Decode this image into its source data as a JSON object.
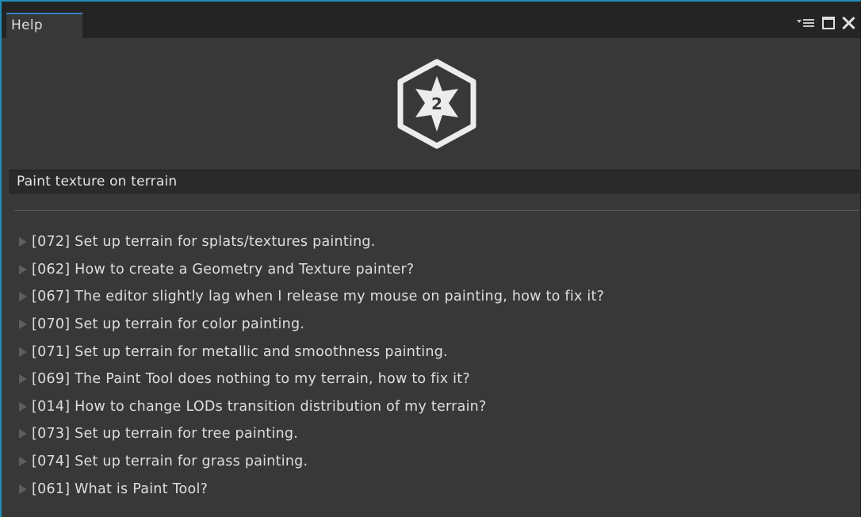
{
  "window": {
    "tab_title": "Help"
  },
  "logo": {
    "badge_text": "2",
    "icon": "star-hexagon-logo-icon"
  },
  "search": {
    "value": "Paint texture on terrain"
  },
  "results": [
    {
      "label": "[072] Set up terrain for splats/textures painting."
    },
    {
      "label": "[062] How to create a Geometry and Texture painter?"
    },
    {
      "label": "[067] The editor slightly lag when I release my mouse on painting, how to fix it?"
    },
    {
      "label": "[070] Set up terrain for color painting."
    },
    {
      "label": "[071] Set up terrain for metallic and smoothness painting."
    },
    {
      "label": "[069] The Paint Tool does nothing to my terrain, how to fix it?"
    },
    {
      "label": "[014] How to change LODs transition distribution of my terrain?"
    },
    {
      "label": "[073] Set up terrain for tree painting."
    },
    {
      "label": "[074] Set up terrain for grass painting."
    },
    {
      "label": "[061] What is Paint Tool?"
    }
  ],
  "colors": {
    "background": "#383838",
    "titlebar": "#242424",
    "accent": "#1e8fb6",
    "text": "#dedede",
    "arrow": "#5e5e5e"
  }
}
